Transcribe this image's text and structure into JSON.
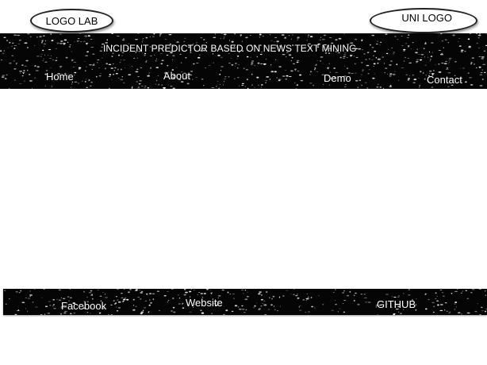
{
  "logos": {
    "lab": "LOGO LAB",
    "uni": "UNI LOGO"
  },
  "header": {
    "title": "INCIDENT PREDICTOR BASED ON NEWS TEXT MINING",
    "nav": {
      "home": "Home",
      "about": "About",
      "demo": "Demo",
      "contact": "Contact"
    }
  },
  "footer": {
    "facebook": "Facebook",
    "website": "Website",
    "github": "GITHUB"
  },
  "colors": {
    "band": "#050505",
    "text": "#ffffff",
    "background": "#ffffff"
  }
}
